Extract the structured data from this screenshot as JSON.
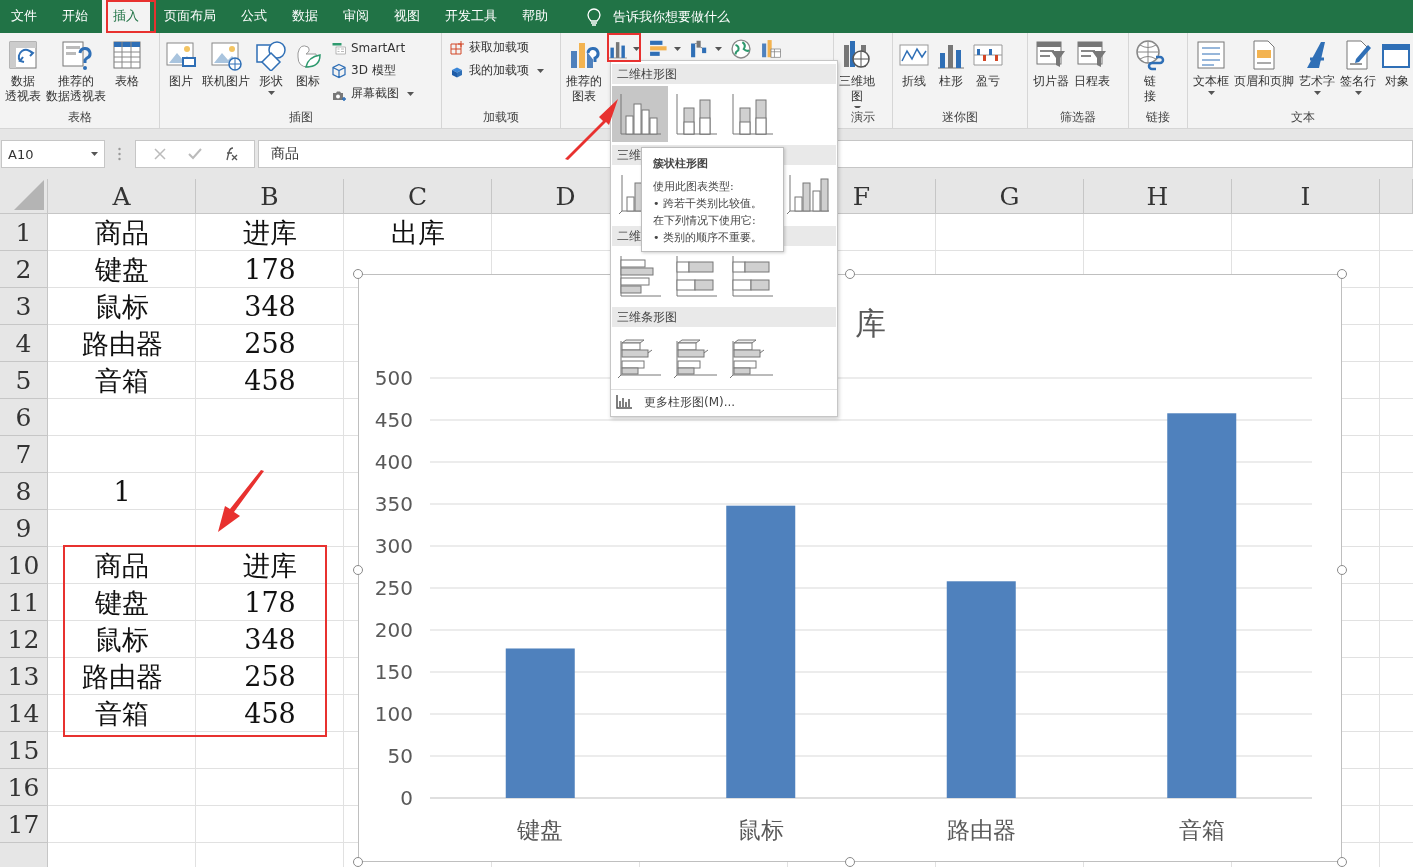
{
  "menu_tabs": [
    {
      "label": "文件",
      "selected": false
    },
    {
      "label": "开始",
      "selected": false
    },
    {
      "label": "插入",
      "selected": true
    },
    {
      "label": "页面布局",
      "selected": false
    },
    {
      "label": "公式",
      "selected": false
    },
    {
      "label": "数据",
      "selected": false
    },
    {
      "label": "审阅",
      "selected": false
    },
    {
      "label": "视图",
      "selected": false
    },
    {
      "label": "开发工具",
      "selected": false
    },
    {
      "label": "帮助",
      "selected": false
    }
  ],
  "tell_me": {
    "placeholder": "告诉我你想要做什么"
  },
  "ribbon_groups": [
    {
      "label": "表格",
      "items": [
        {
          "kind": "large",
          "lines": [
            "数据",
            "透视表"
          ],
          "menu": false
        },
        {
          "kind": "large",
          "lines": [
            "推荐的",
            "数据透视表"
          ],
          "menu": false
        },
        {
          "kind": "large",
          "lines": [
            "表格"
          ],
          "menu": false
        }
      ]
    },
    {
      "label": "插图",
      "items": [
        {
          "kind": "large",
          "lines": [
            "图片"
          ],
          "menu": false
        },
        {
          "kind": "large",
          "lines": [
            "联机图片"
          ],
          "menu": false
        },
        {
          "kind": "large",
          "lines": [
            "形状"
          ],
          "menu": true
        },
        {
          "kind": "large",
          "lines": [
            "图标"
          ],
          "menu": false
        },
        {
          "kind": "stack",
          "buttons": [
            {
              "label": "SmartArt",
              "menu": false
            },
            {
              "label": "3D 模型",
              "menu": false
            },
            {
              "label": "屏幕截图",
              "menu": true
            }
          ]
        }
      ]
    },
    {
      "label": "加载项",
      "items": [
        {
          "kind": "stack",
          "buttons": [
            {
              "label": "获取加载项",
              "menu": false
            },
            {
              "label": "我的加载项",
              "menu": true
            }
          ]
        }
      ]
    },
    {
      "items": [
        {
          "kind": "large",
          "lines": [
            "推荐的",
            "图表"
          ],
          "menu": false
        },
        {
          "kind": "iconrow",
          "buttons": [
            {
              "menu": true
            },
            {
              "menu": true
            },
            {
              "menu": true
            },
            {
              "menu": false
            },
            {
              "menu": false
            }
          ]
        }
      ]
    },
    {
      "label": "演示",
      "items": [
        {
          "kind": "large",
          "lines": [
            "三维地",
            "图"
          ],
          "menu": true
        }
      ]
    },
    {
      "label": "迷你图",
      "items": [
        {
          "kind": "large",
          "lines": [
            "折线"
          ],
          "menu": false
        },
        {
          "kind": "large",
          "lines": [
            "柱形"
          ],
          "menu": false
        },
        {
          "kind": "large",
          "lines": [
            "盈亏"
          ],
          "menu": false
        }
      ]
    },
    {
      "label": "筛选器",
      "items": [
        {
          "kind": "large",
          "lines": [
            "切片器"
          ],
          "menu": false
        },
        {
          "kind": "large",
          "lines": [
            "日程表"
          ],
          "menu": false
        }
      ]
    },
    {
      "label": "链接",
      "items": [
        {
          "kind": "large",
          "lines": [
            "链",
            "接"
          ],
          "menu": false
        }
      ]
    },
    {
      "label": "文本",
      "items": [
        {
          "kind": "large",
          "lines": [
            "文本框"
          ],
          "menu": true
        },
        {
          "kind": "large",
          "lines": [
            "页眉和页脚"
          ],
          "menu": false
        },
        {
          "kind": "large",
          "lines": [
            "艺术字"
          ],
          "menu": true
        },
        {
          "kind": "large",
          "lines": [
            "签名行"
          ],
          "menu": true
        },
        {
          "kind": "large",
          "lines": [
            "对象"
          ],
          "menu": false
        }
      ]
    }
  ],
  "formula_bar": {
    "name_box": "A10",
    "value": "商品"
  },
  "sheet": {
    "columns": [
      "A",
      "B",
      "C",
      "D",
      null,
      "F",
      "G",
      "H",
      "I"
    ],
    "rows": [
      {
        "header": "1",
        "cells": [
          "商品",
          "进库",
          "出库"
        ]
      },
      {
        "header": "2",
        "cells": [
          "键盘",
          "178"
        ]
      },
      {
        "header": "3",
        "cells": [
          "鼠标",
          "348"
        ]
      },
      {
        "header": "4",
        "cells": [
          "路由器",
          "258"
        ]
      },
      {
        "header": "5",
        "cells": [
          "音箱",
          "458"
        ]
      },
      {
        "header": "6"
      },
      {
        "header": "7"
      },
      {
        "header": "8",
        "cells": [
          "1"
        ]
      },
      {
        "header": "9"
      },
      {
        "header": "10",
        "cells": [
          "商品",
          "进库"
        ]
      },
      {
        "header": "11",
        "cells": [
          "键盘",
          "178"
        ]
      },
      {
        "header": "12",
        "cells": [
          "鼠标",
          "348"
        ]
      },
      {
        "header": "13",
        "cells": [
          "路由器",
          "258"
        ]
      },
      {
        "header": "14",
        "cells": [
          "音箱",
          "458"
        ]
      },
      {
        "header": "15"
      },
      {
        "header": "16"
      },
      {
        "header": "17"
      }
    ]
  },
  "chart": {
    "chart_data": {
      "type": "bar",
      "title": "库",
      "grid": true,
      "categories": [
        "键盘",
        "鼠标",
        "路由器",
        "音箱"
      ],
      "series": [
        {
          "color": "#4f81bd",
          "values": [
            178,
            348,
            258,
            458
          ]
        }
      ],
      "ylim": [
        0,
        500
      ],
      "yticks": [
        0,
        50,
        100,
        150,
        200,
        250,
        300,
        350,
        400,
        450,
        500
      ]
    }
  },
  "chart_menu": {
    "sections": [
      {
        "title": "二维柱形图",
        "kind": "flatcolumn",
        "items": [
          {
            "selected": true
          },
          {
            "selected": false
          },
          {
            "selected": false
          }
        ]
      },
      {
        "title": "三维",
        "kind": "solidcolumn",
        "items": [
          {
            "selected": false
          },
          {
            "selected": false
          }
        ]
      },
      {
        "title": "二维",
        "kind": "flatbar",
        "items": [
          {
            "selected": false
          },
          {
            "selected": false
          },
          {
            "selected": false
          }
        ]
      },
      {
        "title": "三维条形图",
        "kind": "solidbar",
        "items": [
          {
            "selected": false
          },
          {
            "selected": false
          },
          {
            "selected": false
          }
        ]
      }
    ],
    "more": "更多柱形图(M)..."
  },
  "tooltip": {
    "title": "簇状柱形图",
    "lines": [
      "使用此图表类型:",
      "• 跨若干类别比较值。",
      "在下列情况下使用它:",
      "• 类别的顺序不重要。"
    ]
  }
}
